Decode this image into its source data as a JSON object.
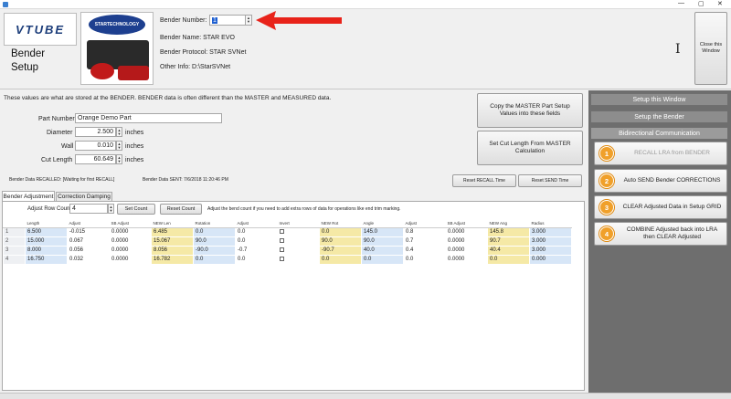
{
  "window": {
    "min": "—",
    "max": "▢",
    "close": "✕"
  },
  "header": {
    "logo_text": "VTUBE",
    "screen_title_line1": "Bender",
    "screen_title_line2": "Setup",
    "brand_badge": "STARTECHNOLOGY",
    "bender_number_label": "Bender Number:",
    "bender_number_value": "1",
    "bender_name": "Bender Name: STAR EVO",
    "bender_protocol": "Bender Protocol: STAR SVNet",
    "other_info": "Other Info: D:\\StarSVNet",
    "cursor_glyph": "I",
    "close_button": "Close this Window"
  },
  "info_text": "These values are what are stored at the BENDER.  BENDER data is often different than the MASTER and MEASURED data.",
  "fields": {
    "part_number_label": "Part Number",
    "part_number_value": "Orange Demo Part",
    "diameter_label": "Diameter",
    "diameter_value": "2.500",
    "diameter_unit": "inches",
    "wall_label": "Wall",
    "wall_value": "0.010",
    "wall_unit": "inches",
    "cut_length_label": "Cut Length",
    "cut_length_value": "60.649",
    "cut_length_unit": "inches"
  },
  "actions": {
    "copy_master": "Copy the MASTER Part Setup Values into these fields",
    "set_cut_length": "Set Cut Length From MASTER Calculation",
    "reset_recall": "Reset RECALL Time",
    "reset_send": "Reset SEND Time"
  },
  "status": {
    "recalled": "Bender Data RECALLED: [Waiting for first RECALL]",
    "sent": "Bender Data SENT: 7/6/2018 11:20:46 PM"
  },
  "tabs": {
    "bender_adjustment": "Bender Adjustment",
    "correction_damping": "Correction Damping"
  },
  "row_count": {
    "label": "Adjust Row Count:",
    "value": "4",
    "set_count": "Set Count",
    "reset_count": "Reset Count",
    "hint": "Adjust the bend count if you need to add extra rows of data for operations like end trim marking."
  },
  "grid": {
    "headers": [
      "",
      "Length",
      "Adjust",
      "SB Adjust",
      "NEW Len",
      "Rotation",
      "Adjust",
      "Invert",
      "NEW Rot",
      "Angle",
      "Adjust",
      "SB Adjust",
      "NEW Ang",
      "Radius"
    ],
    "rows": [
      {
        "n": "1",
        "length": "6.500",
        "adj": "-0.015",
        "sb": "0.0000",
        "newlen": "6.485",
        "rot": "0.0",
        "radj": "0.0",
        "newrot": "0.0",
        "angle": "145.0",
        "aadj": "0.8",
        "asb": "0.0000",
        "newang": "145.8",
        "radius": "3.000"
      },
      {
        "n": "2",
        "length": "15.000",
        "adj": "0.067",
        "sb": "0.0000",
        "newlen": "15.067",
        "rot": "90.0",
        "radj": "0.0",
        "newrot": "90.0",
        "angle": "90.0",
        "aadj": "0.7",
        "asb": "0.0000",
        "newang": "90.7",
        "radius": "3.000"
      },
      {
        "n": "3",
        "length": "8.000",
        "adj": "0.056",
        "sb": "0.0000",
        "newlen": "8.056",
        "rot": "-90.0",
        "radj": "-0.7",
        "newrot": "-90.7",
        "angle": "40.0",
        "aadj": "0.4",
        "asb": "0.0000",
        "newang": "40.4",
        "radius": "3.000"
      },
      {
        "n": "4",
        "length": "16.750",
        "adj": "0.032",
        "sb": "0.0000",
        "newlen": "16.782",
        "rot": "0.0",
        "radj": "0.0",
        "newrot": "0.0",
        "angle": "0.0",
        "aadj": "0.0",
        "asb": "0.0000",
        "newang": "0.0",
        "radius": "0.000"
      }
    ]
  },
  "sidebar": {
    "setup_window": "Setup this Window",
    "setup_bender": "Setup the Bender",
    "bidirectional": "Bidirectional Communication",
    "steps": [
      {
        "num": "1",
        "label": "RECALL LRA from BENDER",
        "enabled": false
      },
      {
        "num": "2",
        "label": "Auto SEND Bender CORRECTIONS",
        "enabled": true
      },
      {
        "num": "3",
        "label": "CLEAR Adjusted Data in Setup GRID",
        "enabled": true
      },
      {
        "num": "4",
        "label": "COMBINE Adjusted back into LRA then CLEAR Adjusted",
        "enabled": true
      }
    ]
  },
  "colors": {
    "accent_orange": "#f0a02a",
    "arrow_red": "#e8231a",
    "sidebar_gray": "#8d8d8d"
  }
}
